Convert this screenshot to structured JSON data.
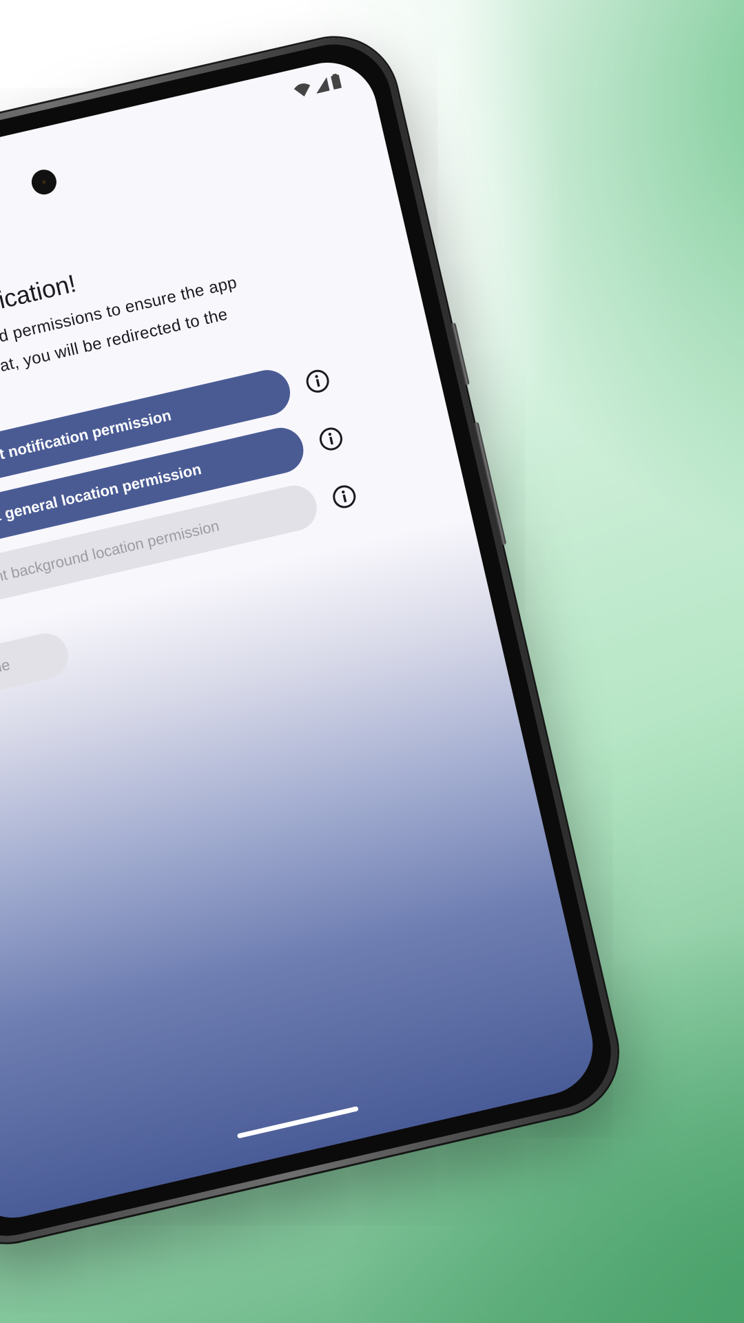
{
  "welcome": {
    "title": "Welcome to Geofication!",
    "description": "Please grant the required permissions to ensure the app works correctly. After that, you will be redirected to the home screen."
  },
  "permissions": [
    {
      "label": "Grant notification permission",
      "enabled": true
    },
    {
      "label": "Grant general location permission",
      "enabled": true
    },
    {
      "label": "Grant background location permission",
      "enabled": false
    }
  ],
  "continue_label": "Continue",
  "icons": {
    "info": "info-icon",
    "wifi": "wifi-icon",
    "signal": "signal-icon",
    "battery": "battery-icon"
  },
  "colors": {
    "primary": "#4a5b94",
    "disabled_bg": "#e2e1e7",
    "disabled_text": "#9c9ba3",
    "screen_bg": "#f8f7fc"
  }
}
